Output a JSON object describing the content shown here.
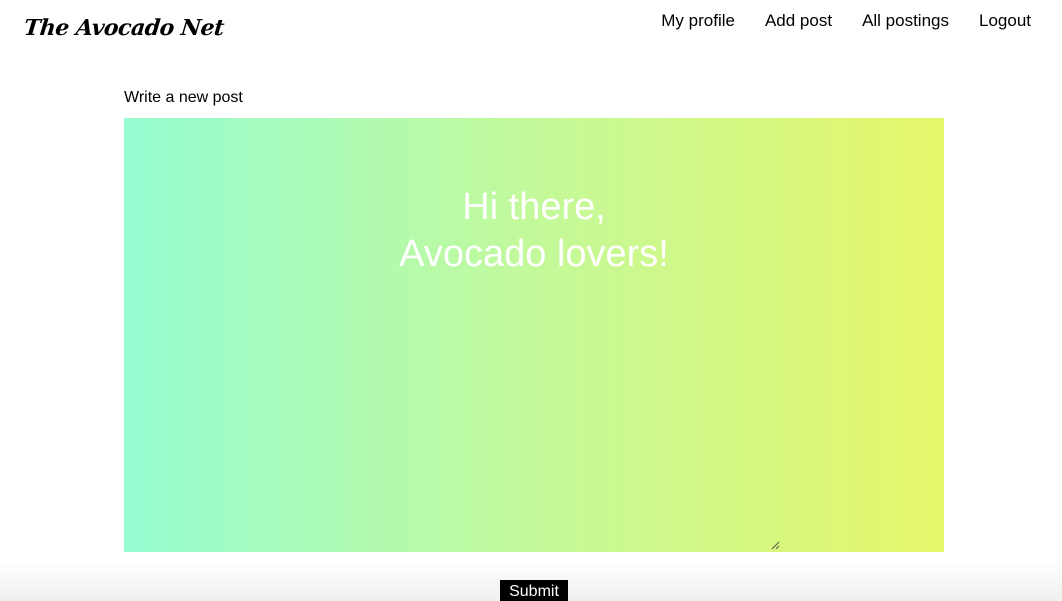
{
  "header": {
    "logo": "The Avocado Net",
    "nav": [
      {
        "label": "My profile"
      },
      {
        "label": "Add post"
      },
      {
        "label": "All postings"
      },
      {
        "label": "Logout"
      }
    ]
  },
  "form": {
    "label": "Write a new post",
    "textarea": {
      "line1": "Hi there,",
      "line2": "Avocado lovers!",
      "gradient": [
        "#96fdd2",
        "#c3f99a",
        "#e6f66a"
      ]
    },
    "submit_label": "Submit"
  }
}
